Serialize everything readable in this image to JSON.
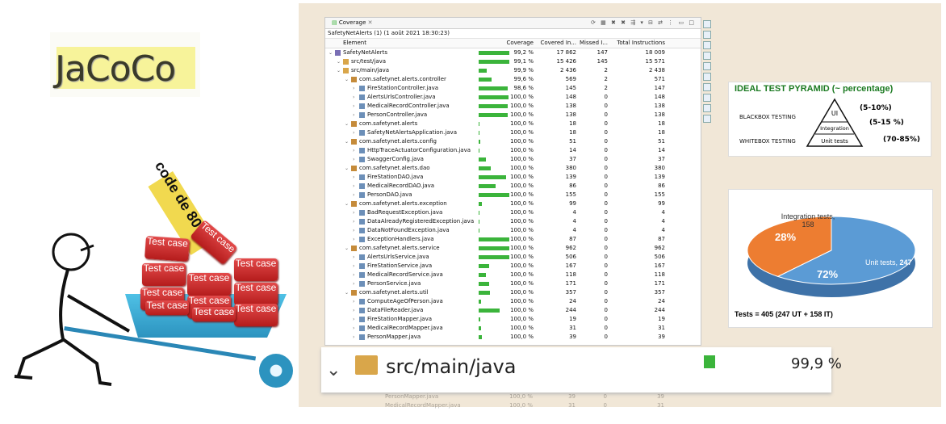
{
  "left": {
    "logo_text": "JaCoCo",
    "sign_text": "code de 80 %",
    "bricks": [
      "Test case",
      "Test case",
      "Test case",
      "Test case",
      "Test case",
      "Test case",
      "Test case",
      "Test case",
      "Test case",
      "Test case",
      "Test case"
    ]
  },
  "panel": {
    "tab_label": "Coverage",
    "session": "SafetyNetAlerts (1) (1 août 2021 18:30:23)",
    "columns": {
      "element": "Element",
      "coverage": "Coverage",
      "covered": "Covered In...",
      "missed": "Missed I...",
      "total": "Total Instructions"
    },
    "rows": [
      {
        "level": 0,
        "type": "project",
        "name": "SafetyNetAlerts",
        "coverage": "99,2 %",
        "fill": 0.992,
        "covered": "17 862",
        "missed": "147",
        "total": "18 009"
      },
      {
        "level": 1,
        "type": "srcfolder",
        "name": "src/test/java",
        "coverage": "99,1 %",
        "fill": 0.991,
        "covered": "15 426",
        "missed": "145",
        "total": "15 571"
      },
      {
        "level": 1,
        "type": "srcfolder",
        "name": "src/main/java",
        "coverage": "99,9 %",
        "fill": 0.25,
        "covered": "2 436",
        "missed": "2",
        "total": "2 438"
      },
      {
        "level": 2,
        "type": "package",
        "name": "com.safetynet.alerts.controller",
        "coverage": "99,6 %",
        "fill": 0.42,
        "covered": "569",
        "missed": "2",
        "total": "571"
      },
      {
        "level": 3,
        "type": "file",
        "name": "FireStationController.java",
        "coverage": "98,6 %",
        "fill": 0.96,
        "covered": "145",
        "missed": "2",
        "total": "147"
      },
      {
        "level": 3,
        "type": "file",
        "name": "AlertsUrlsController.java",
        "coverage": "100,0 %",
        "fill": 0.98,
        "covered": "148",
        "missed": "0",
        "total": "148"
      },
      {
        "level": 3,
        "type": "file",
        "name": "MedicalRecordController.java",
        "coverage": "100,0 %",
        "fill": 0.96,
        "covered": "138",
        "missed": "0",
        "total": "138"
      },
      {
        "level": 3,
        "type": "file",
        "name": "PersonController.java",
        "coverage": "100,0 %",
        "fill": 0.96,
        "covered": "138",
        "missed": "0",
        "total": "138"
      },
      {
        "level": 2,
        "type": "package",
        "name": "com.safetynet.alerts",
        "coverage": "100,0 %",
        "fill": 0.02,
        "covered": "18",
        "missed": "0",
        "total": "18"
      },
      {
        "level": 3,
        "type": "file",
        "name": "SafetyNetAlertsApplication.java",
        "coverage": "100,0 %",
        "fill": 0.02,
        "covered": "18",
        "missed": "0",
        "total": "18"
      },
      {
        "level": 2,
        "type": "package",
        "name": "com.safetynet.alerts.config",
        "coverage": "100,0 %",
        "fill": 0.06,
        "covered": "51",
        "missed": "0",
        "total": "51"
      },
      {
        "level": 3,
        "type": "file",
        "name": "HttpTraceActuatorConfiguration.java",
        "coverage": "100,0 %",
        "fill": 0.02,
        "covered": "14",
        "missed": "0",
        "total": "14"
      },
      {
        "level": 3,
        "type": "file",
        "name": "SwaggerConfig.java",
        "coverage": "100,0 %",
        "fill": 0.24,
        "covered": "37",
        "missed": "0",
        "total": "37"
      },
      {
        "level": 2,
        "type": "package",
        "name": "com.safetynet.alerts.dao",
        "coverage": "100,0 %",
        "fill": 0.4,
        "covered": "380",
        "missed": "0",
        "total": "380"
      },
      {
        "level": 3,
        "type": "file",
        "name": "FireStationDAO.java",
        "coverage": "100,0 %",
        "fill": 0.9,
        "covered": "139",
        "missed": "0",
        "total": "139"
      },
      {
        "level": 3,
        "type": "file",
        "name": "MedicalRecordDAO.java",
        "coverage": "100,0 %",
        "fill": 0.55,
        "covered": "86",
        "missed": "0",
        "total": "86"
      },
      {
        "level": 3,
        "type": "file",
        "name": "PersonDAO.java",
        "coverage": "100,0 %",
        "fill": 1.0,
        "covered": "155",
        "missed": "0",
        "total": "155"
      },
      {
        "level": 2,
        "type": "package",
        "name": "com.safetynet.alerts.exception",
        "coverage": "100,0 %",
        "fill": 0.1,
        "covered": "99",
        "missed": "0",
        "total": "99"
      },
      {
        "level": 3,
        "type": "file",
        "name": "BadRequestException.java",
        "coverage": "100,0 %",
        "fill": 0.03,
        "covered": "4",
        "missed": "0",
        "total": "4"
      },
      {
        "level": 3,
        "type": "file",
        "name": "DataAlreadyRegisteredException.java",
        "coverage": "100,0 %",
        "fill": 0.03,
        "covered": "4",
        "missed": "0",
        "total": "4"
      },
      {
        "level": 3,
        "type": "file",
        "name": "DataNotFoundException.java",
        "coverage": "100,0 %",
        "fill": 0.03,
        "covered": "4",
        "missed": "0",
        "total": "4"
      },
      {
        "level": 3,
        "type": "file",
        "name": "ExceptionHandlers.java",
        "coverage": "100,0 %",
        "fill": 1.0,
        "covered": "87",
        "missed": "0",
        "total": "87"
      },
      {
        "level": 2,
        "type": "package",
        "name": "com.safetynet.alerts.service",
        "coverage": "100,0 %",
        "fill": 1.0,
        "covered": "962",
        "missed": "0",
        "total": "962"
      },
      {
        "level": 3,
        "type": "file",
        "name": "AlertsUrlsService.java",
        "coverage": "100,0 %",
        "fill": 1.0,
        "covered": "506",
        "missed": "0",
        "total": "506"
      },
      {
        "level": 3,
        "type": "file",
        "name": "FireStationService.java",
        "coverage": "100,0 %",
        "fill": 0.33,
        "covered": "167",
        "missed": "0",
        "total": "167"
      },
      {
        "level": 3,
        "type": "file",
        "name": "MedicalRecordService.java",
        "coverage": "100,0 %",
        "fill": 0.23,
        "covered": "118",
        "missed": "0",
        "total": "118"
      },
      {
        "level": 3,
        "type": "file",
        "name": "PersonService.java",
        "coverage": "100,0 %",
        "fill": 0.34,
        "covered": "171",
        "missed": "0",
        "total": "171"
      },
      {
        "level": 2,
        "type": "package",
        "name": "com.safetynet.alerts.util",
        "coverage": "100,0 %",
        "fill": 0.37,
        "covered": "357",
        "missed": "0",
        "total": "357"
      },
      {
        "level": 3,
        "type": "file",
        "name": "ComputeAgeOfPerson.java",
        "coverage": "100,0 %",
        "fill": 0.07,
        "covered": "24",
        "missed": "0",
        "total": "24"
      },
      {
        "level": 3,
        "type": "file",
        "name": "DataFileReader.java",
        "coverage": "100,0 %",
        "fill": 0.68,
        "covered": "244",
        "missed": "0",
        "total": "244"
      },
      {
        "level": 3,
        "type": "file",
        "name": "FireStationMapper.java",
        "coverage": "100,0 %",
        "fill": 0.05,
        "covered": "19",
        "missed": "0",
        "total": "19"
      },
      {
        "level": 3,
        "type": "file",
        "name": "MedicalRecordMapper.java",
        "coverage": "100,0 %",
        "fill": 0.09,
        "covered": "31",
        "missed": "0",
        "total": "31"
      },
      {
        "level": 3,
        "type": "file",
        "name": "PersonMapper.java",
        "coverage": "100,0 %",
        "fill": 0.11,
        "covered": "39",
        "missed": "0",
        "total": "39"
      }
    ]
  },
  "zoom": {
    "label": "src/main/java",
    "coverage": "99,9 %"
  },
  "reflection": [
    {
      "name": "PersonMapper.java",
      "coverage": "100,0 %",
      "covered": "39",
      "missed": "0",
      "total": "39"
    },
    {
      "name": "MedicalRecordMapper.java",
      "coverage": "100,0 %",
      "covered": "31",
      "missed": "0",
      "total": "31"
    }
  ],
  "pyramid": {
    "title": "IDEAL TEST PYRAMID (~ percentage)",
    "blackbox": "BLACKBOX TESTING",
    "whitebox": "WHITEBOX TESTING",
    "tiers": [
      {
        "label": "UI",
        "pct": "(5-10%)"
      },
      {
        "label": "Integration",
        "pct": "(5-15 %)"
      },
      {
        "label": "Unit tests",
        "pct": "(70-85%)"
      }
    ]
  },
  "pie": {
    "colors": {
      "unit": "#5b9bd5",
      "integration": "#ed7d31"
    },
    "slices": [
      {
        "label": "Integration tests,",
        "value": 158,
        "value_text": "158",
        "pct": "28%"
      },
      {
        "label": "Unit tests,",
        "value": 247,
        "value_text": "247",
        "pct": "72%"
      }
    ],
    "footer": "Tests = 405 (247 UT + 158 IT)"
  }
}
